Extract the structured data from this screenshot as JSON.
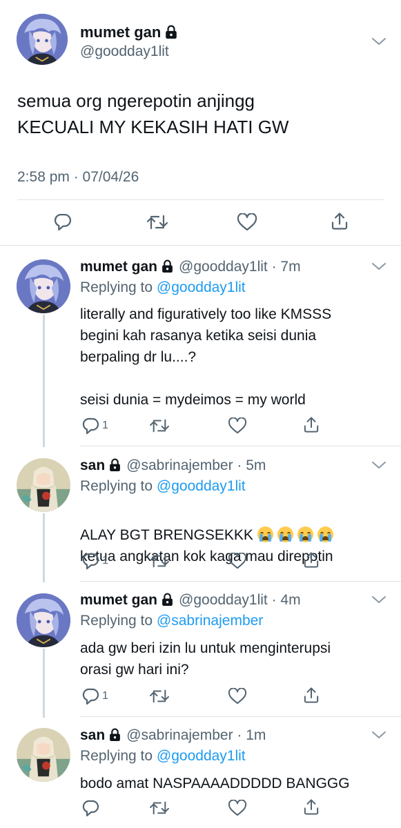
{
  "main_tweet": {
    "author_name": "mumet gan",
    "handle": "@goodday1lit",
    "text": "semua org ngerepotin anjingg\nKECUALI MY KEKASIH HATI GW",
    "timestamp": "2:58 pm · 07/04/26",
    "icons": [
      "lock-icon",
      "chevron-down-icon",
      "reply-icon",
      "retweet-icon",
      "like-icon",
      "share-icon"
    ]
  },
  "replies": [
    {
      "author_name": "mumet gan",
      "handle_time": "@goodday1lit · 7m",
      "replying_prefix": "Replying to",
      "replying_to": "@goodday1lit",
      "text": "literally and figuratively too like KMSSS\nbegini kah rasanya ketika seisi dunia\nberpaling dr lu....?\n\nseisi dunia = mydeimos = my world",
      "reply_count": "1"
    },
    {
      "author_name": "san",
      "handle_time": "@sabrinajember · 5m",
      "replying_prefix": "Replying to",
      "replying_to": "@goodday1lit",
      "text_line1": "ALAY BGT BRENGSEKKK",
      "text_line2": "ketua angkatan kok kaga mau direpotin",
      "emoji": "loudly-crying-face",
      "reply_count": "1"
    },
    {
      "author_name": "mumet gan",
      "handle_time": "@goodday1lit · 4m",
      "replying_prefix": "Replying to",
      "replying_to": "@sabrinajember",
      "text": "ada gw beri izin lu untuk menginterupsi\norasi gw hari ini?",
      "reply_count": "1"
    },
    {
      "author_name": "san",
      "handle_time": "@sabrinajember · 1m",
      "replying_prefix": "Replying to",
      "replying_to": "@goodday1lit",
      "text": "bodo amat NASPAAAADDDDD BANGGG",
      "reply_count": ""
    }
  ],
  "colors": {
    "link": "#1d9bf0",
    "secondary": "#536471",
    "divider": "#dfe3e6",
    "thread": "#cfd9de"
  }
}
